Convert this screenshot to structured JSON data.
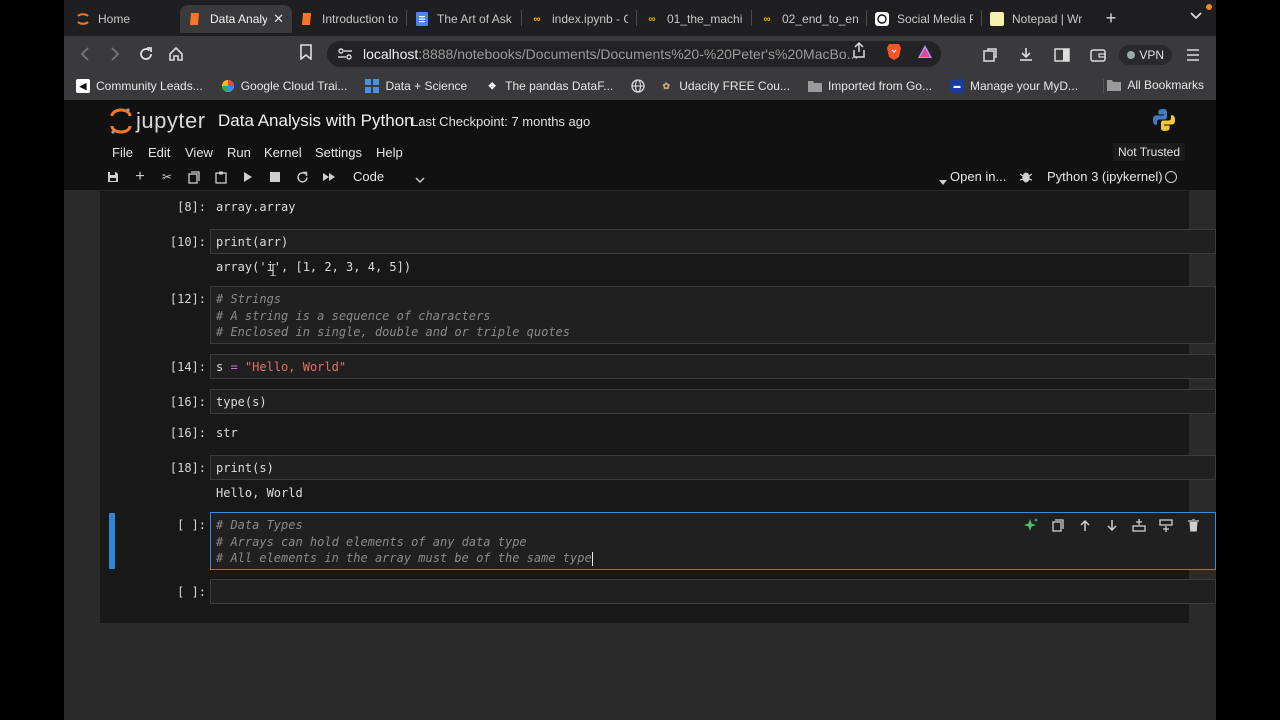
{
  "browser": {
    "tabs": [
      {
        "title": "Home",
        "icon": "jupyter-icon",
        "active": false
      },
      {
        "title": "Data Analy",
        "icon": "notebook-icon",
        "active": true
      },
      {
        "title": "Introduction to",
        "icon": "notebook-icon",
        "active": false
      },
      {
        "title": "The Art of Ask",
        "icon": "docs-icon",
        "active": false
      },
      {
        "title": "index.ipynb - C",
        "icon": "colab-icon",
        "active": false
      },
      {
        "title": "01_the_machi",
        "icon": "colab-icon",
        "active": false
      },
      {
        "title": "02_end_to_en",
        "icon": "colab-icon",
        "active": false
      },
      {
        "title": "Social Media P",
        "icon": "chatgpt-icon",
        "active": false
      },
      {
        "title": "Notepad | Writ",
        "icon": "notepad-icon",
        "active": false
      }
    ],
    "url_host": "localhost",
    "url_path": ":8888/notebooks/Documents/Documents%20-%20Peter's%20MacBo...",
    "vpn_label": "VPN",
    "bookmarks": [
      {
        "label": "Community Leads...",
        "icon": "community-icon"
      },
      {
        "label": "Google Cloud Trai...",
        "icon": "google-icon"
      },
      {
        "label": "Data + Science",
        "icon": "grid-icon"
      },
      {
        "label": "The pandas DataF...",
        "icon": "pandas-icon"
      },
      {
        "label": "",
        "icon": "globe-icon"
      },
      {
        "label": "Udacity FREE Cou...",
        "icon": "udacity-icon"
      },
      {
        "label": "Imported from Go...",
        "icon": "folder-icon"
      },
      {
        "label": "Manage your MyD...",
        "icon": "myd-icon"
      }
    ],
    "all_bookmarks_label": "All Bookmarks"
  },
  "jupyter": {
    "logo_text": "jupyter",
    "notebook_title": "Data Analysis with Python",
    "checkpoint": "Last Checkpoint: 7 months ago",
    "menu": [
      "File",
      "Edit",
      "View",
      "Run",
      "Kernel",
      "Settings",
      "Help"
    ],
    "trust_status": "Not Trusted",
    "cell_type": "Code",
    "open_in_label": "Open in...",
    "kernel_name": "Python 3 (ipykernel)"
  },
  "cells": [
    {
      "id": "out8",
      "kind": "output",
      "prompt": "[8]:",
      "text": "array.array"
    },
    {
      "id": "c10",
      "kind": "code",
      "prompt": "[10]:",
      "source": "print(arr)",
      "output": "array('i', [1, 2, 3, 4, 5])"
    },
    {
      "id": "c12",
      "kind": "code",
      "prompt": "[12]:",
      "lines": [
        "# Strings",
        "# A string is a sequence of characters",
        "# Enclosed in single, double and or triple quotes"
      ]
    },
    {
      "id": "c14",
      "kind": "code",
      "prompt": "[14]:",
      "var": "s",
      "op": "=",
      "str": "\"Hello, World\""
    },
    {
      "id": "c16",
      "kind": "code",
      "prompt": "[16]:",
      "source": "type(s)",
      "out_prompt": "[16]:",
      "output": "str"
    },
    {
      "id": "c18",
      "kind": "code",
      "prompt": "[18]:",
      "source": "print(s)",
      "output": "Hello, World"
    },
    {
      "id": "cactive",
      "kind": "code",
      "prompt": "[ ]:",
      "lines": [
        "# Data Types",
        "# Arrays can hold elements of any data type",
        "# All elements in the array must be of the same type"
      ]
    },
    {
      "id": "cempty",
      "kind": "code",
      "prompt": "[ ]:",
      "source": ""
    }
  ]
}
